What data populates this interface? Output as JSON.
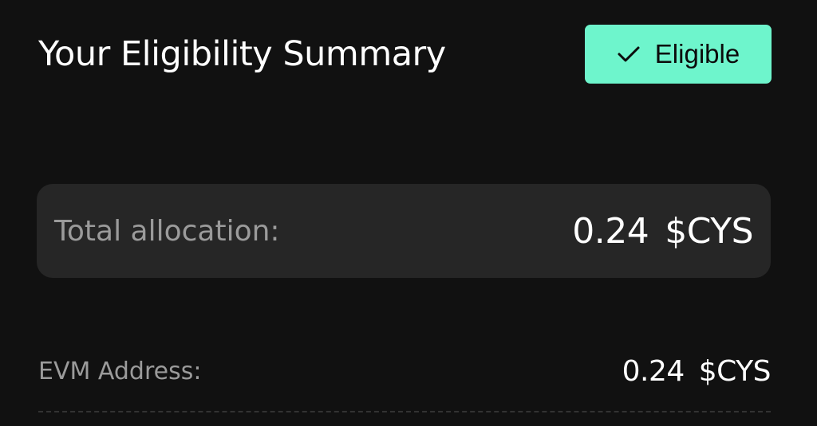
{
  "summary": {
    "title": "Your Eligibility Summary",
    "status_badge": {
      "label": "Eligible",
      "icon": "check-icon",
      "color": "#6ef5cc"
    }
  },
  "allocation": {
    "label": "Total allocation:",
    "amount": "0.24",
    "token": "$CYS"
  },
  "evm": {
    "label": "EVM Address:",
    "amount": "0.24",
    "token": "$CYS"
  }
}
